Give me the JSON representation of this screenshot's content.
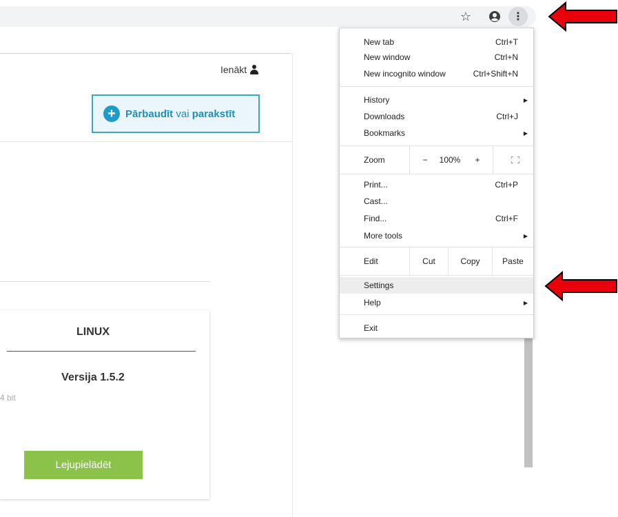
{
  "toolbar": {
    "star_icon": "☆",
    "account_icon": "👤",
    "menu_icon": "⋮"
  },
  "page": {
    "login_label": "Ienākt",
    "verify_button": {
      "part1": "Pārbaudīt",
      "part2": " vai ",
      "part3": "parakstīt"
    },
    "card": {
      "title": "LINUX",
      "version": "Versija 1.5.2",
      "bit_text": "4 bit",
      "download_label": "Lejupielādēt"
    }
  },
  "menu": {
    "new_tab": {
      "label": "New tab",
      "shortcut": "Ctrl+T"
    },
    "new_window": {
      "label": "New window",
      "shortcut": "Ctrl+N"
    },
    "new_incognito": {
      "label": "New incognito window",
      "shortcut": "Ctrl+Shift+N"
    },
    "history": {
      "label": "History"
    },
    "downloads": {
      "label": "Downloads",
      "shortcut": "Ctrl+J"
    },
    "bookmarks": {
      "label": "Bookmarks"
    },
    "zoom": {
      "label": "Zoom",
      "minus": "−",
      "value": "100%",
      "plus": "+"
    },
    "print": {
      "label": "Print...",
      "shortcut": "Ctrl+P"
    },
    "cast": {
      "label": "Cast..."
    },
    "find": {
      "label": "Find...",
      "shortcut": "Ctrl+F"
    },
    "more_tools": {
      "label": "More tools"
    },
    "edit": {
      "label": "Edit",
      "cut": "Cut",
      "copy": "Copy",
      "paste": "Paste"
    },
    "settings": {
      "label": "Settings"
    },
    "help": {
      "label": "Help"
    },
    "exit": {
      "label": "Exit"
    },
    "submenu_arrow": "▶"
  },
  "colors": {
    "annotation_arrow": "#e8000b",
    "verify_accent": "#1d9ccb",
    "download_green": "#8bc34a"
  }
}
